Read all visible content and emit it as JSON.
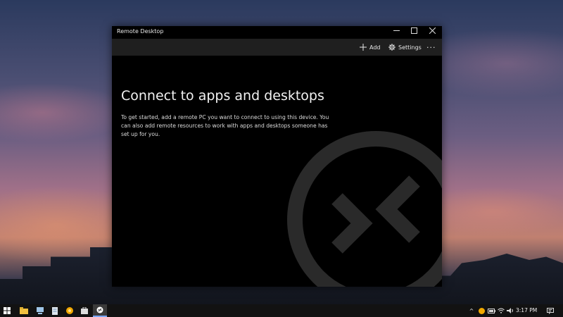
{
  "window": {
    "title": "Remote Desktop",
    "controls": {
      "minimize": "—",
      "maximize": "☐",
      "close": "✕"
    }
  },
  "toolbar": {
    "add_label": "Add",
    "settings_label": "Settings",
    "more_label": "···"
  },
  "main": {
    "heading": "Connect to apps and desktops",
    "description": "To get started, add a remote PC you want to connect to using this device. You can also add remote resources to work with apps and desktops someone has set up for you."
  },
  "taskbar": {
    "icons": [
      "windows-start-icon",
      "file-explorer-icon",
      "computer-icon",
      "document-icon",
      "browser-icon",
      "store-icon",
      "remote-desktop-icon"
    ],
    "tray_chevron": "^",
    "time": "3:17 PM"
  },
  "colors": {
    "window_bg": "#000000",
    "toolbar_bg": "#1f1f1f",
    "taskbar_bg": "#121212"
  }
}
